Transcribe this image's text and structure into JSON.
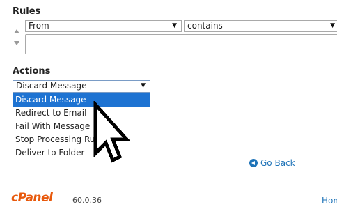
{
  "rules": {
    "heading": "Rules",
    "field_select_value": "From",
    "match_select_value": "contains",
    "value_input": ""
  },
  "actions": {
    "heading": "Actions",
    "selected_value": "Discard Message",
    "options": [
      "Discard Message",
      "Redirect to Email",
      "Fail With Message",
      "Stop Processing Rules",
      "Deliver to Folder"
    ]
  },
  "go_back_label": "Go Back",
  "footer": {
    "logo_text": "cPanel",
    "version": "60.0.36",
    "home_label": "Hom"
  },
  "icons": {
    "move_up": "triangle-up-icon",
    "move_down": "triangle-down-icon",
    "go_back": "arrow-left-circle-icon",
    "cursor": "mouse-pointer-icon"
  },
  "colors": {
    "selected_option_bg": "#1e73d2",
    "link": "#1e73b8",
    "brand": "#e8590c"
  }
}
